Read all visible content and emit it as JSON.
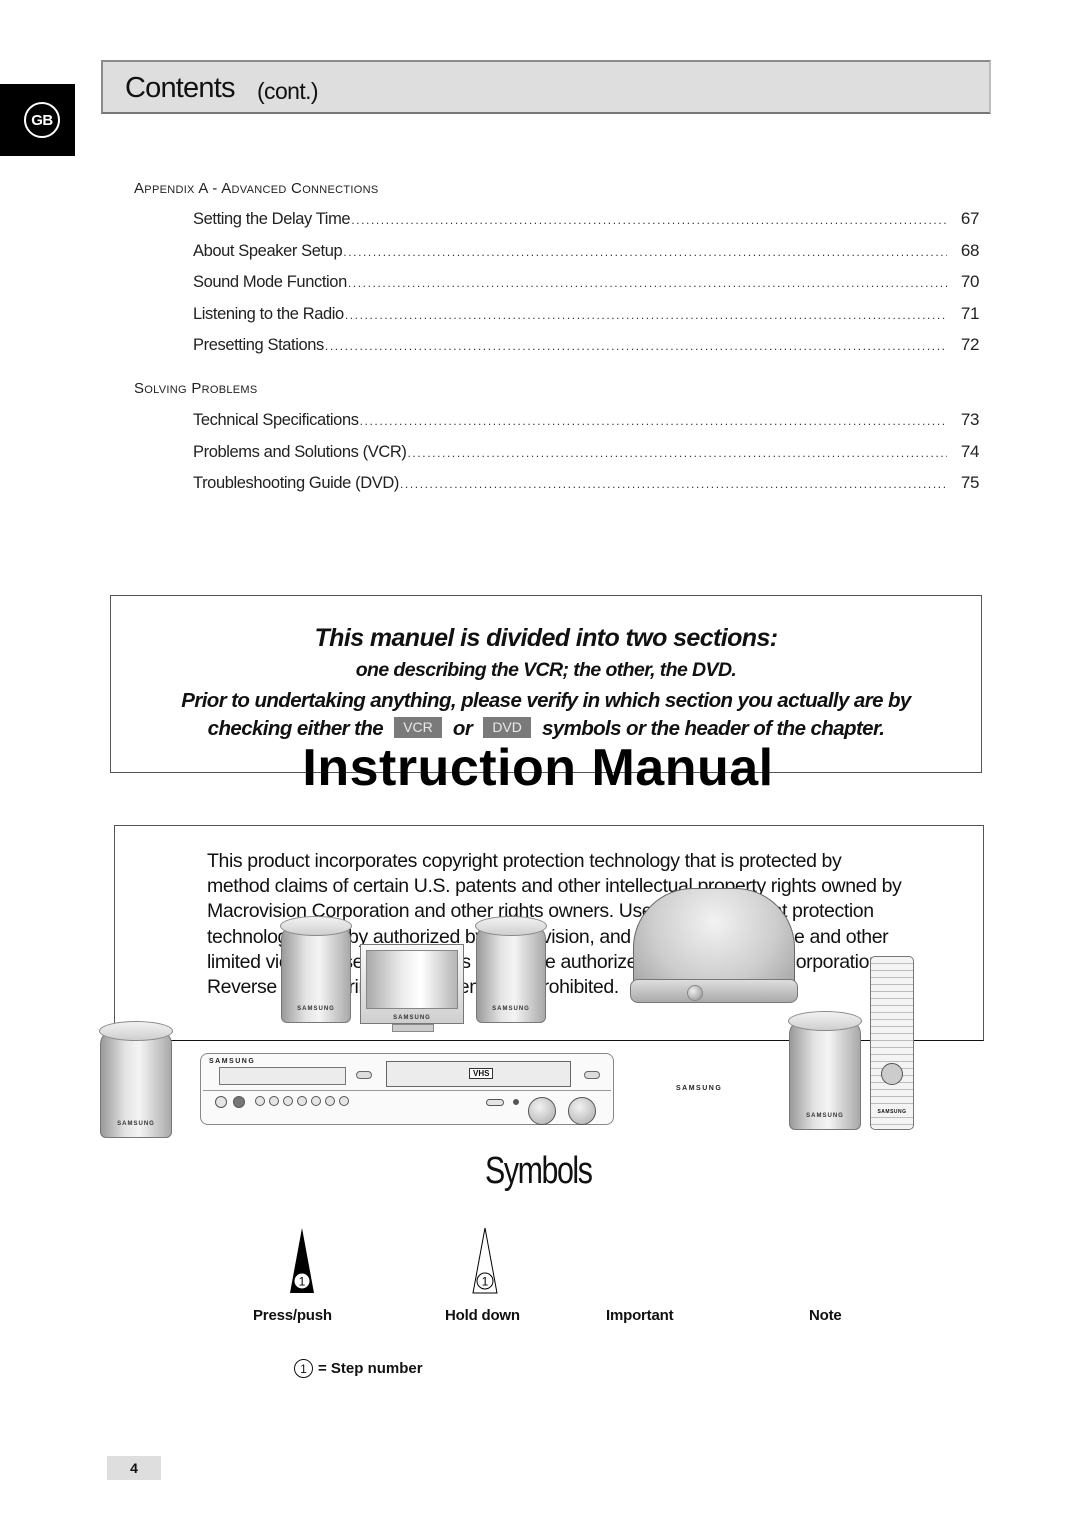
{
  "language_tab": {
    "label": "GB"
  },
  "header": {
    "title": "Contents",
    "subtitle": "(cont.)"
  },
  "toc": {
    "sections": [
      {
        "title": "Appendix A - Advanced Connections",
        "items": [
          {
            "label": "Setting the Delay Time",
            "page": "67"
          },
          {
            "label": "About Speaker Setup",
            "page": "68"
          },
          {
            "label": "Sound Mode Function",
            "page": "70"
          },
          {
            "label": "Listening to the Radio",
            "page": "71"
          },
          {
            "label": "Presetting Stations",
            "page": "72"
          }
        ]
      },
      {
        "title": "Solving Problems",
        "items": [
          {
            "label": "Technical Specifications",
            "page": "73"
          },
          {
            "label": "Problems and Solutions (VCR)",
            "page": "74"
          },
          {
            "label": "Troubleshooting Guide (DVD)",
            "page": "75"
          }
        ]
      }
    ]
  },
  "notice": {
    "heading": "This manuel is divided into two sections:",
    "line1": "one describing the VCR; the other, the DVD.",
    "line2": "Prior to undertaking anything, please verify in which section you actually are by",
    "line3_pre": "checking either the",
    "chip_vcr": "VCR",
    "line3_mid": "or",
    "chip_dvd": "DVD",
    "line3_post": "symbols or the header of the chapter."
  },
  "overlay_title": "Instruction Manual",
  "copyright": {
    "text": "This product incorporates copyright protection technology that is protected by method claims of certain U.S. patents and other intellectual property rights owned by Macrovision Corporation and other rights owners. Use of this copyright protection technology must by authorized by Macrovision, and is intended for home and other limited viewing uses only unless otherwise authorized by Macrovision Corporation. Reverse engineering or disassembly is prohibited."
  },
  "illustration": {
    "brand": "SAMSUNG",
    "vhs_label": "VHS"
  },
  "symbols": {
    "title": "Symbols",
    "items": [
      {
        "label": "Press/push",
        "icon": "press-push-icon",
        "step": "1"
      },
      {
        "label": "Hold down",
        "icon": "hold-down-icon",
        "step": "1"
      },
      {
        "label": "Important",
        "icon": ""
      },
      {
        "label": "Note",
        "icon": ""
      }
    ],
    "step_legend_number": "1",
    "step_legend_text": "= Step number"
  },
  "page_number": "4"
}
